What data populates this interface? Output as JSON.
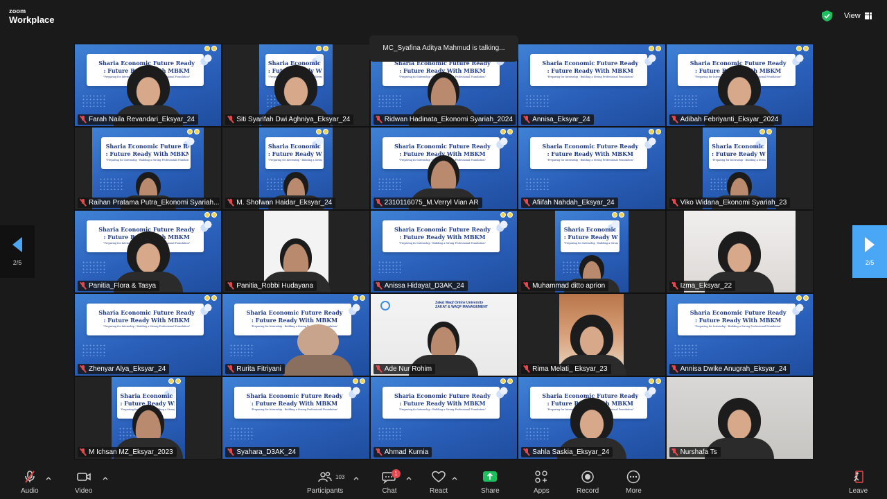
{
  "window": {
    "brand_small": "zoom",
    "brand_large": "Workplace",
    "view_label": "View"
  },
  "talking_banner": "MC_Syafina Aditya Mahmud is talking...",
  "slide": {
    "line1": "Sharia Economic Future Ready",
    "line2": ": Future Ready With MBKM",
    "line3": "\"Preparing for Internship - Building a Strong Professional Foundation\""
  },
  "participants": [
    {
      "name": "Farah Naila Revandari_Eksyar_24",
      "video": "slide",
      "person": "hijab"
    },
    {
      "name": "Siti Syarifah Dwi Aghniya_Eksyar_24",
      "video": "slide-narrow",
      "person": "hijab"
    },
    {
      "name": "Ridwan Hadinata_Ekonomi Syariah_2024",
      "video": "slide",
      "person": "man"
    },
    {
      "name": "Annisa_Eksyar_24",
      "video": "slide",
      "person": "none"
    },
    {
      "name": "Adibah Febriyanti_Eksyar_2024",
      "video": "slide",
      "person": "hijab"
    },
    {
      "name": "Raihan Pratama Putra_Ekonomi Syariah...",
      "video": "slide-mid",
      "person": "man-small"
    },
    {
      "name": "M. Shofwan Haidar_Eksyar_24",
      "video": "slide-narrow",
      "person": "man-small"
    },
    {
      "name": "2310116075_M.Verryl Vian AR",
      "video": "slide",
      "person": "man"
    },
    {
      "name": "Afiifah Nahdah_Eksyar_24",
      "video": "slide",
      "person": "none"
    },
    {
      "name": "Viko Widana_Ekonomi Syariah_23",
      "video": "slide-narrow",
      "person": "man-small"
    },
    {
      "name": "Panitia_Flora & Tasya",
      "video": "slide",
      "person": "hijab"
    },
    {
      "name": "Panitia_Robbi Hudayana",
      "video": "white-narrow",
      "person": "man"
    },
    {
      "name": "Anissa Hidayat_D3AK_24",
      "video": "slide",
      "person": "none"
    },
    {
      "name": "Muhammad ditto aprion",
      "video": "slide-narrow",
      "person": "man-small"
    },
    {
      "name": "Izma_Eksyar_22",
      "video": "izma",
      "person": "hijab"
    },
    {
      "name": "Zhenyar Alya_Eksyar_24",
      "video": "slide",
      "person": "none"
    },
    {
      "name": "Rurita Fitriyani",
      "video": "slide",
      "person": "blur"
    },
    {
      "name": "Ade Nur Rohim",
      "video": "white",
      "person": "man"
    },
    {
      "name": "Rima Melati_ Eksyar_23",
      "video": "wood",
      "person": "hijab"
    },
    {
      "name": "Annisa Dwike Anugrah_Eksyar_24",
      "video": "slide",
      "person": "none"
    },
    {
      "name": "M Ichsan MZ_Eksyar_2023",
      "video": "slide-narrow",
      "person": "man"
    },
    {
      "name": "Syahara_D3AK_24",
      "video": "slide",
      "person": "none"
    },
    {
      "name": "Ahmad Kurnia",
      "video": "slide",
      "person": "none"
    },
    {
      "name": "Sahla Saskia_Eksyar_24",
      "video": "slide",
      "person": "hijab"
    },
    {
      "name": "Nurshafa Ts",
      "video": "grey",
      "person": "hijab"
    }
  ],
  "zakat_text": "Zakat Waqf Online University ZAKAT & WAQF MANAGEMENT",
  "pager": {
    "left": "2/5",
    "right": "2/5"
  },
  "toolbar": {
    "audio": "Audio",
    "video": "Video",
    "participants": "Participants",
    "participants_count": "103",
    "chat": "Chat",
    "chat_badge": "1",
    "react": "React",
    "share": "Share",
    "apps": "Apps",
    "record": "Record",
    "more": "More",
    "leave": "Leave"
  },
  "colors": {
    "accent": "#4aa7f5",
    "share_green": "#1fbf5f",
    "muted_red": "#e5484d",
    "shield_green": "#1fbf5f"
  }
}
